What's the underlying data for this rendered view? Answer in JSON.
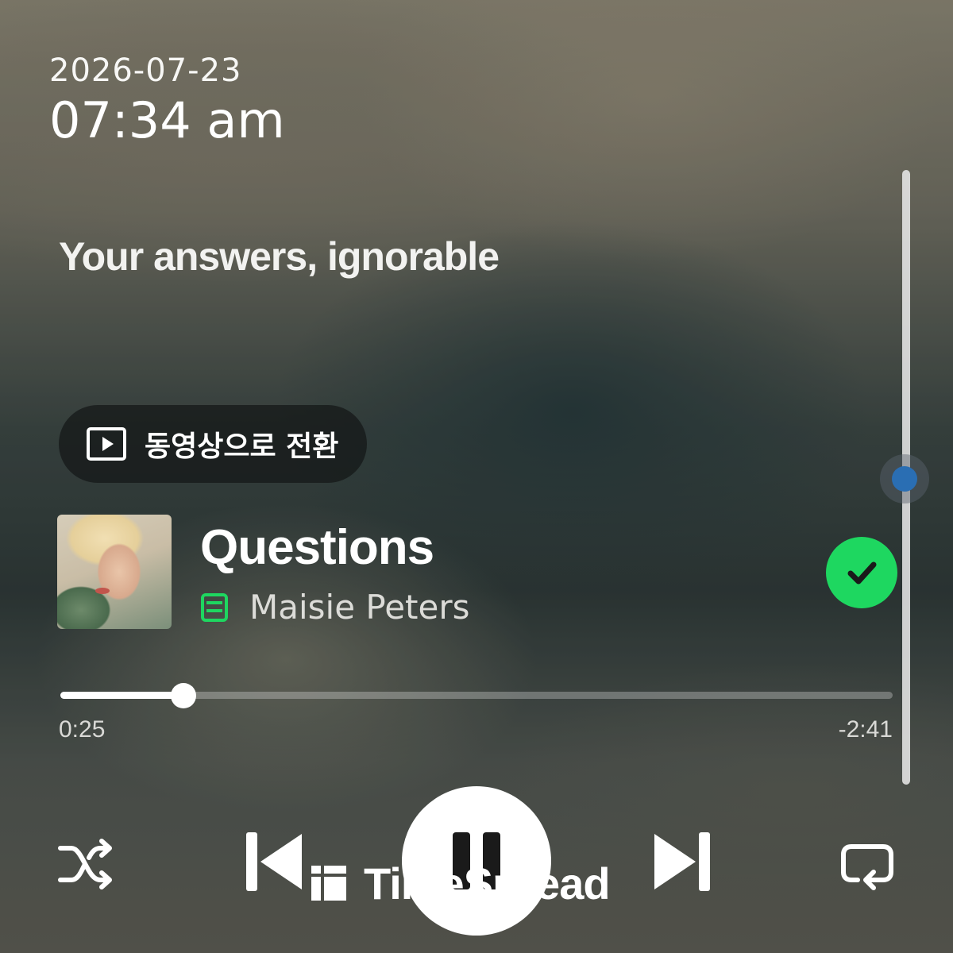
{
  "status": {
    "date": "2026-07-23",
    "time": "07:34 am"
  },
  "lyrics": {
    "current_line": "Your answers, ignorable"
  },
  "video_toggle": {
    "label": "동영상으로 전환",
    "icon": "play-square-icon"
  },
  "track": {
    "title": "Questions",
    "artist": "Maisie Peters",
    "artist_badge_icon": "lyrics-badge-icon",
    "saved": true,
    "saved_icon": "check-circle-icon"
  },
  "playback": {
    "elapsed": "0:25",
    "remaining": "-2:41",
    "progress_fraction": 0.148,
    "state": "playing"
  },
  "lyrics_scroll_fraction": 0.5,
  "controls": {
    "shuffle_icon": "shuffle-icon",
    "previous_icon": "skip-previous-icon",
    "pause_icon": "pause-icon",
    "next_icon": "skip-next-icon",
    "repeat_icon": "repeat-icon"
  },
  "watermark": {
    "text": "TimeSpread",
    "icon": "timespread-logo-icon"
  },
  "colors": {
    "accent_green": "#1ed760",
    "scroll_thumb_blue": "#2a6eb3",
    "text_primary": "#ffffff",
    "text_secondary": "#dcdcd8"
  }
}
